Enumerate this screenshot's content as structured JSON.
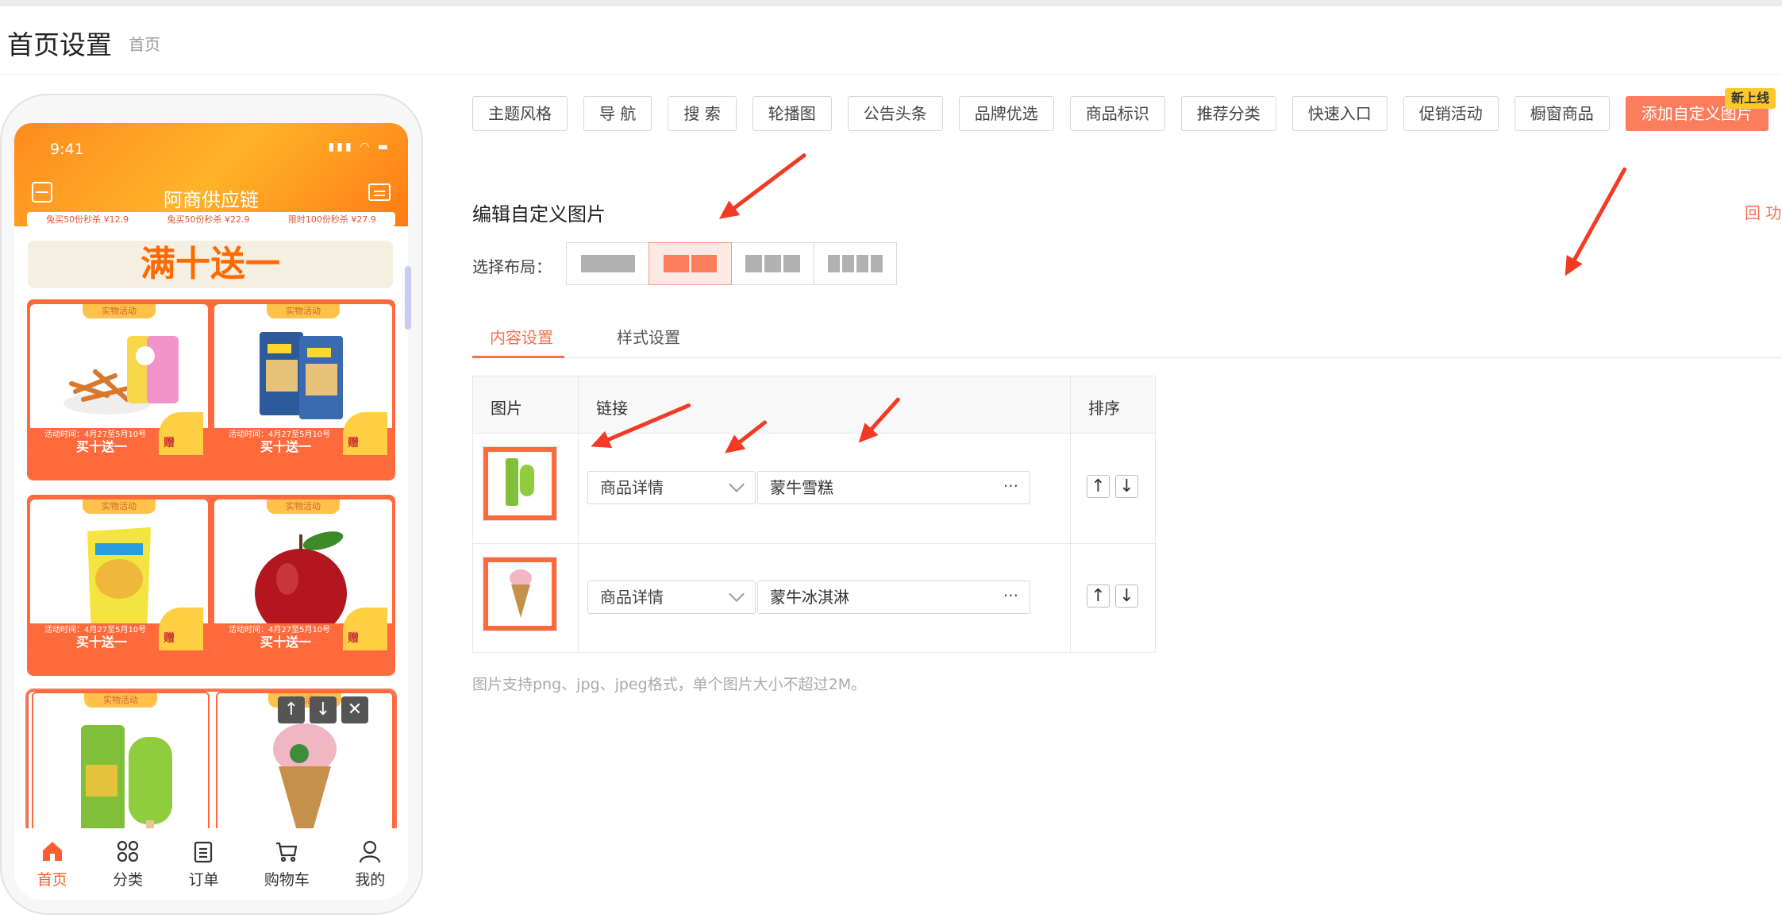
{
  "page": {
    "title": "首页设置",
    "breadcrumb": "首页"
  },
  "phone": {
    "time": "9:41",
    "shop_name": "阿商供应链",
    "promo_strip": [
      "兔买50份秒杀 ¥12.9",
      "兔买50份秒杀 ¥22.9",
      "限时100份秒杀 ¥27.9"
    ],
    "banner": "满十送一",
    "activity_tag": "实物活动",
    "activity_time": "活动时间：4月27至5月10号",
    "buy_label": "买十送一",
    "gift_label": "赠",
    "product_rows": [
      {
        "left": "chips",
        "right": "snack-bag"
      },
      {
        "left": "banana-chips",
        "right": "apple"
      },
      {
        "left": "mung-bean-popsicle",
        "right": "ice-cream-cone"
      }
    ],
    "tabbar": [
      {
        "label": "首页",
        "icon": "home-icon",
        "active": true
      },
      {
        "label": "分类",
        "icon": "grid-icon",
        "active": false
      },
      {
        "label": "订单",
        "icon": "clipboard-icon",
        "active": false
      },
      {
        "label": "购物车",
        "icon": "cart-icon",
        "active": false
      },
      {
        "label": "我的",
        "icon": "user-icon",
        "active": false
      }
    ]
  },
  "module_tabs": [
    "主题风格",
    "导 航",
    "搜 索",
    "轮播图",
    "公告头条",
    "品牌优选",
    "商品标识",
    "推荐分类",
    "快速入口",
    "促销活动",
    "橱窗商品",
    "添加自定义图片"
  ],
  "new_badge": "新上线",
  "editor": {
    "title": "编辑自定义图片",
    "restore_label": "回 功",
    "layout_label": "选择布局：",
    "layout_selected": 2,
    "sub_tabs": [
      "内容设置",
      "样式设置"
    ],
    "table_headers": {
      "image": "图片",
      "link": "链接",
      "sort": "排序"
    },
    "rows": [
      {
        "link_type": "商品详情",
        "link_value": "蒙牛雪糕"
      },
      {
        "link_type": "商品详情",
        "link_value": "蒙牛冰淇淋"
      }
    ],
    "more": "···",
    "hint": "图片支持png、jpg、jpeg格式，单个图片大小不超过2M。"
  },
  "colors": {
    "accent": "#fb7d5c",
    "phone_orange": "#ff6a3d",
    "arrow": "#f23a24",
    "badge": "#ffc72c"
  }
}
